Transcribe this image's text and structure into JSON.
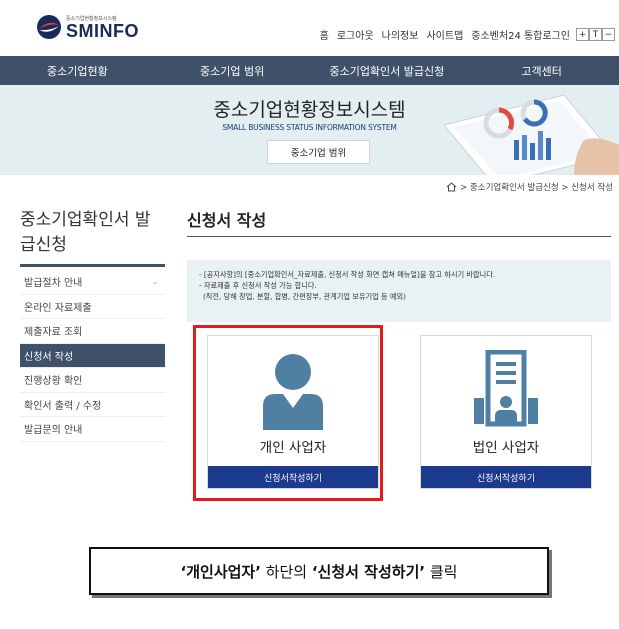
{
  "header": {
    "logo_small": "중소기업현황정보시스템",
    "logo_big": "SMINFO",
    "util_links": [
      "홈",
      "로그아웃",
      "나의정보",
      "사이트맵",
      "중소벤처24 통합로그인"
    ],
    "size_buttons": [
      "+",
      "T",
      "−"
    ]
  },
  "nav": [
    "중소기업현황",
    "중소기업 범위",
    "중소기업확인서 발급신청",
    "고객센터"
  ],
  "banner": {
    "title": "중소기업현황정보시스템",
    "subtitle": "SMALL BUSINESS STATUS INFORMATION SYSTEM",
    "button": "중소기업 범위"
  },
  "breadcrumb": "> 중소기업확인서 발급신청 > 신청서 작성",
  "sidebar": {
    "title_line1": "중소기업확인서 발",
    "title_line2": "급신청",
    "items": [
      {
        "label": "발급절차 안내",
        "arrow": "⌄"
      },
      {
        "label": "온라인 자료제출"
      },
      {
        "label": "제출자료 조회"
      },
      {
        "label": "신청서 작성",
        "active": true
      },
      {
        "label": "진행상황 확인"
      },
      {
        "label": "확인서 출력 / 수정"
      },
      {
        "label": "발급문의 안내"
      }
    ]
  },
  "main": {
    "title": "신청서 작성",
    "notice": [
      "- [공지사항]의 [중소기업확인서_자료제출, 신청서 작성 화면 캡쳐 매뉴얼]을 참고 하시기 바랍니다.",
      "- 자료제출 후 신청서 작성 가능 합니다.",
      "  (직전, 당해 창업, 분할, 합병, 간편장부, 관계기업 보유기업 등 예외)"
    ],
    "cards": [
      {
        "label": "개인 사업자",
        "button": "신청서작성하기"
      },
      {
        "label": "법인 사업자",
        "button": "신청서작성하기"
      }
    ]
  },
  "caption": {
    "q1": "‘개인사업자’",
    "mid": " 하단의 ",
    "q2": "‘신청서 작성하기’",
    "end": " 클릭"
  },
  "colors": {
    "nav_bg": "#3e5168",
    "banner_bg": "#e3eef1",
    "button_blue": "#1c3a8e",
    "icon_blue": "#4f7fa3",
    "highlight_red": "#e31b1b"
  }
}
